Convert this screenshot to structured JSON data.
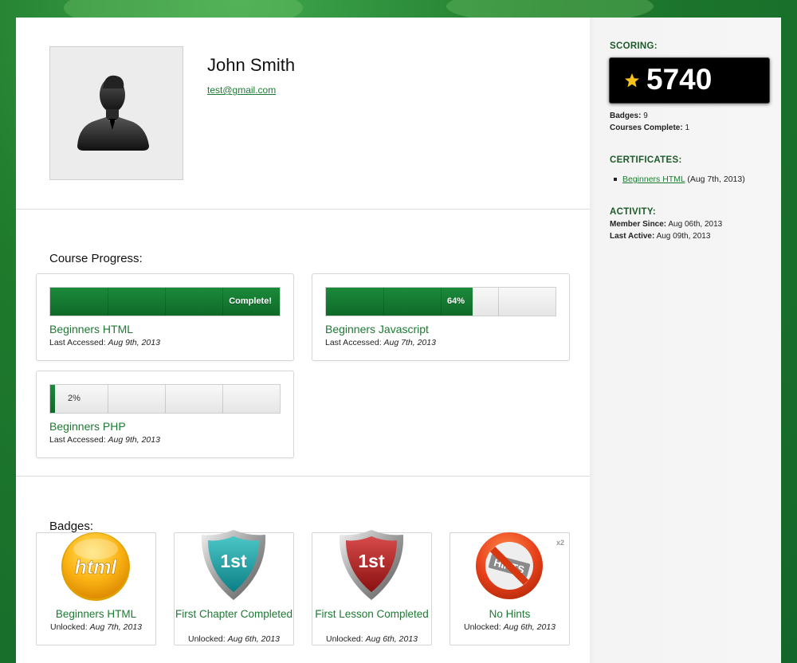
{
  "profile": {
    "name": "John Smith",
    "email": "test@gmail.com"
  },
  "progress": {
    "title": "Course Progress:",
    "courses": [
      {
        "name": "Beginners HTML",
        "label": "Complete!",
        "percent": 100,
        "accessed_prefix": "Last Accessed:",
        "accessed": "Aug 9th, 2013"
      },
      {
        "name": "Beginners Javascript",
        "label": "64%",
        "percent": 64,
        "accessed_prefix": "Last Accessed:",
        "accessed": "Aug 7th, 2013"
      },
      {
        "name": "Beginners PHP",
        "label": "2%",
        "percent": 2,
        "accessed_prefix": "Last Accessed:",
        "accessed": "Aug 9th, 2013"
      }
    ]
  },
  "badges": {
    "title": "Badges:",
    "items": [
      {
        "title": "Beginners HTML",
        "icon": "html-badge-icon",
        "icon_text": "html",
        "unlocked_prefix": "Unlocked:",
        "unlocked": "Aug 7th, 2013"
      },
      {
        "title": "First Chapter Completed",
        "icon": "shield-1st-teal-icon",
        "icon_text": "1st",
        "unlocked_prefix": "Unlocked:",
        "unlocked": "Aug 6th, 2013"
      },
      {
        "title": "First Lesson Completed",
        "icon": "shield-1st-red-icon",
        "icon_text": "1st",
        "unlocked_prefix": "Unlocked:",
        "unlocked": "Aug 6th, 2013"
      },
      {
        "title": "No Hints",
        "icon": "no-hints-icon",
        "icon_text": "HINTS",
        "count": "x2",
        "unlocked_prefix": "Unlocked:",
        "unlocked": "Aug 6th, 2013"
      }
    ]
  },
  "sidebar": {
    "scoring_title": "SCORING:",
    "score": "5740",
    "badges_label": "Badges:",
    "badges_value": "9",
    "courses_label": "Courses Complete:",
    "courses_value": "1",
    "certificates_title": "CERTIFICATES:",
    "certificate_name": "Beginners HTML",
    "certificate_date": "(Aug 7th, 2013)",
    "activity_title": "ACTIVITY:",
    "member_label": "Member Since:",
    "member_value": "Aug 06th, 2013",
    "active_label": "Last Active:",
    "active_value": "Aug 09th, 2013"
  },
  "colors": {
    "accent": "#1d7a33",
    "progress_fill": "#137030",
    "score_bg": "#000000"
  }
}
